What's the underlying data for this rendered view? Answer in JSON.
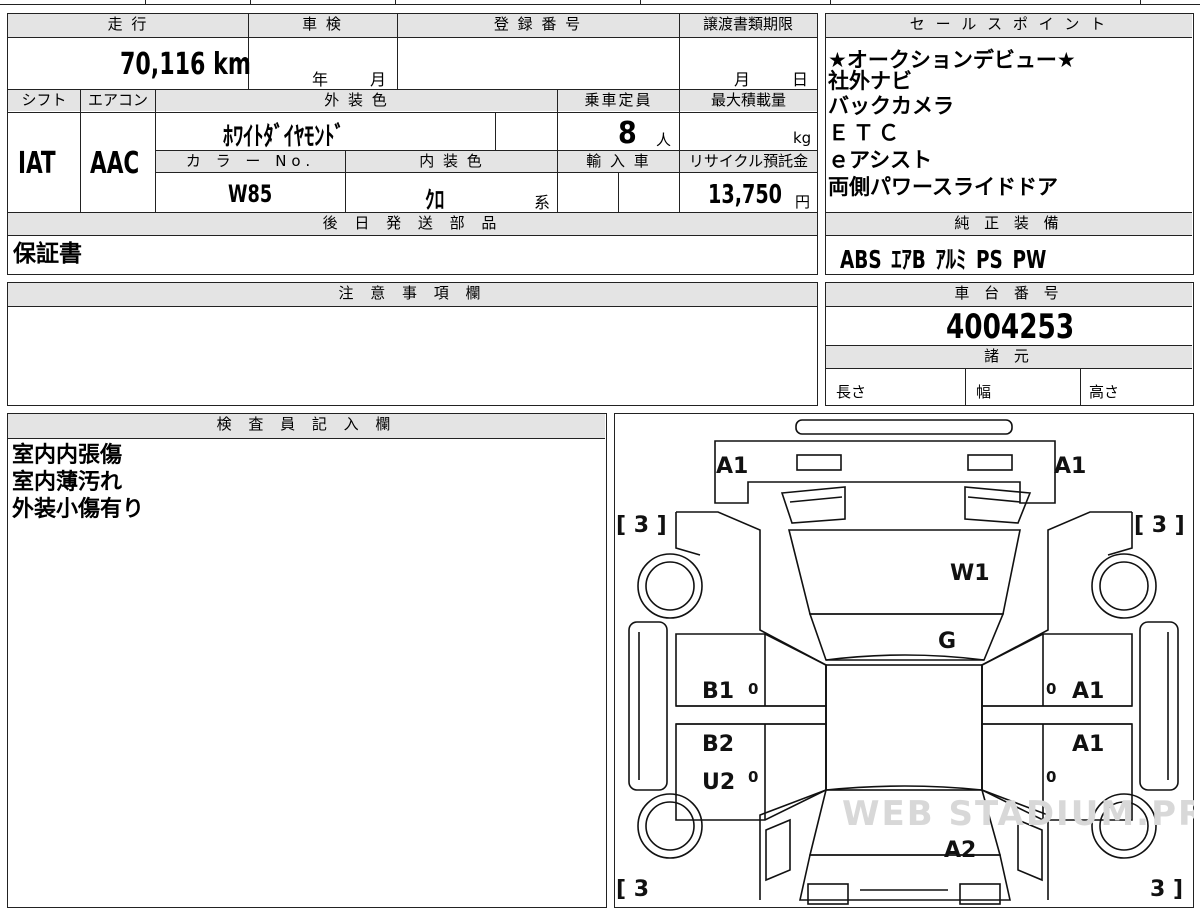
{
  "header": {
    "mileage_label": "走 行",
    "inspection_label": "車 検",
    "registration_label": "登 録 番 号",
    "transfer_deadline_label": "譲渡書類期限",
    "mileage_value": "70,116 km",
    "inspection_year": "年",
    "inspection_month": "月",
    "transfer_month": "月",
    "transfer_day": "日"
  },
  "row2": {
    "shift_label": "シフト",
    "aircon_label": "エアコン",
    "exterior_color_label": "外 装 色",
    "capacity_label": "乗車定員",
    "max_load_label": "最大積載量",
    "shift_value": "IAT",
    "aircon_value": "AAC",
    "exterior_color_value": "ﾎﾜｲﾄﾀﾞｲﾔﾓﾝﾄﾞ",
    "capacity_value": "8",
    "capacity_unit": "人",
    "max_load_unit": "kg"
  },
  "row3": {
    "color_no_label": "カ ラ ー No.",
    "interior_color_label": "内 装 色",
    "import_label": "輸 入 車",
    "recycle_label": "リサイクル預託金",
    "color_no_value": "W85",
    "interior_color_value": "ｸﾛ",
    "interior_suffix": "系",
    "recycle_value": "13,750",
    "recycle_unit": "円"
  },
  "later_parts": {
    "label": "後 日 発 送 部 品",
    "value": "保証書"
  },
  "sales_points": {
    "label": "セ ー ル ス ポ イ ン ト",
    "items": [
      "★オークションデビュー★",
      "社外ナビ",
      "バックカメラ",
      "ＥＴＣ",
      "ｅアシスト",
      "両側パワースライドドア"
    ]
  },
  "equipment": {
    "label": "純 正 装 備",
    "value": "ABS ｴｱB ｱﾙﾐ PS PW"
  },
  "notes": {
    "label": "注 意 事 項 欄"
  },
  "chassis": {
    "label": "車 台 番 号",
    "value": "4004253"
  },
  "specs": {
    "label": "諸 元",
    "length_label": "長さ",
    "width_label": "幅",
    "height_label": "高さ"
  },
  "inspector": {
    "label": "検 査 員 記 入 欄",
    "lines": [
      "室内内張傷",
      "室内薄汚れ",
      "外装小傷有り"
    ]
  },
  "diagram": {
    "marks": {
      "a1_left": "A1",
      "a1_right": "A1",
      "w1": "W1",
      "g": "G",
      "b1": "B1",
      "b2": "B2",
      "u2": "U2",
      "a1_mid_right": "A1",
      "a1_mid_right_2": "A1",
      "a2": "A2",
      "tread_top_left": "[ 3 ]",
      "tread_top_right": "[ 3 ]",
      "tread_bottom_left": "[ 3",
      "tread_bottom_right": "3 ]",
      "zero_1": "0",
      "zero_2": "0",
      "zero_3": "0",
      "zero_4": "0"
    },
    "watermark": "WEB STADIUM.PRO"
  }
}
